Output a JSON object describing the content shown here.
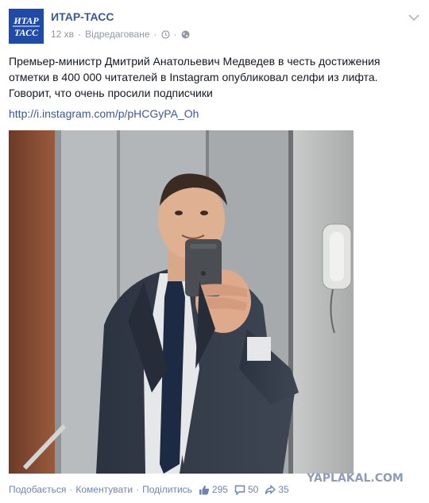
{
  "post": {
    "author": "ИТАР-ТАСС",
    "time": "12 хв",
    "edited": "Відредаговане",
    "text": "Премьер-министр Дмитрий Анатольевич Медведев в честь достижения отметки в 400 000 читателей в Instagram опубликовал селфи из лифта. Говорит, что очень просили подписчики",
    "link": "http://i.instagram.com/p/pHCGyPA_Oh",
    "logo_text_top": "ИТАР",
    "logo_text_bottom": "ТАСС"
  },
  "actions": {
    "like": "Подобається",
    "comment": "Коментувати",
    "share": "Поділитись",
    "likes_count": "295",
    "comments_count": "50",
    "shares_count": "35"
  },
  "watermark": "YAPLAKAL.COM",
  "colors": {
    "link": "#3b5998",
    "logo_bg": "#1f4aa8",
    "meta": "#9197a3"
  },
  "icons": [
    "chevron-down-icon",
    "clock-icon",
    "globe-icon",
    "thumbs-up-icon",
    "comment-icon",
    "share-icon"
  ]
}
